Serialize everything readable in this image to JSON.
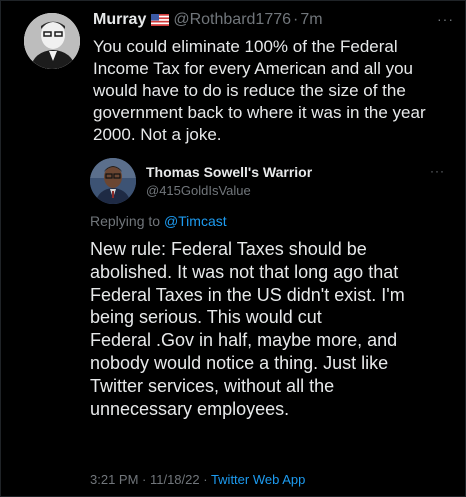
{
  "tweet1": {
    "display_name": "Murray",
    "flag_icon": "us-flag-icon",
    "handle": "@Rothbard1776",
    "separator": "·",
    "time": "7m",
    "more_label": "···",
    "text_lines": [
      "You could eliminate 100% of the Federal",
      "Income Tax for every American and all you",
      "would have to do is reduce the size of the",
      "government back to where it was in the year",
      "2000. Not a joke."
    ]
  },
  "tweet2": {
    "display_name": "Thomas Sowell's Warrior",
    "handle": "@415GoldIsValue",
    "more_label": "···",
    "replying_prefix": "Replying to",
    "replying_mention": "@Timcast",
    "text_lines": [
      "New rule: Federal Taxes should be",
      "abolished. It was not that long ago that",
      "Federal Taxes in the US didn't exist. I'm",
      "being serious. This would cut",
      "Federal .Gov in half, maybe more, and",
      "nobody would notice a thing. Just like",
      "Twitter services, without all the",
      "unnecessary employees."
    ],
    "timestamp": "3:21 PM · 11/18/22 ·",
    "source_app": "Twitter Web App"
  },
  "colors": {
    "background": "#000000",
    "text_primary": "#e7e9ea",
    "text_secondary": "#71767b",
    "accent": "#1d9bf0"
  }
}
